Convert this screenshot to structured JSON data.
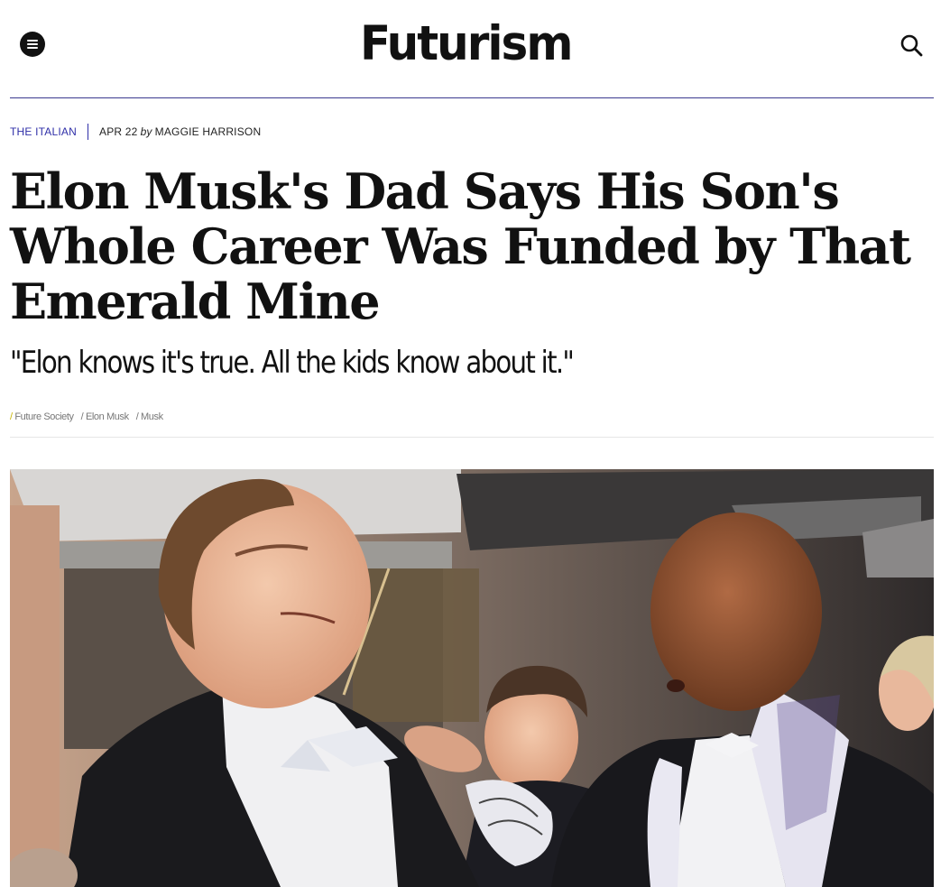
{
  "header": {
    "logo_text": "Futurism",
    "menu_icon": "hamburger-menu-icon",
    "search_icon": "search-icon",
    "rule_color": "#3b3a8f"
  },
  "article": {
    "section": "THE ITALIAN",
    "date": "APR 22",
    "by": "by",
    "author": "MAGGIE HARRISON",
    "headline": "Elon Musk's Dad Says His Son's Whole Career Was Funded by That Emerald Mine",
    "dek": "\"Elon knows it's true. All the kids know about it.\"",
    "tags": [
      "Future Society",
      "Elon Musk",
      "Musk"
    ]
  },
  "colors": {
    "section_accent": "#2f2fa8",
    "tag_slash_accent": "#c8b400"
  }
}
